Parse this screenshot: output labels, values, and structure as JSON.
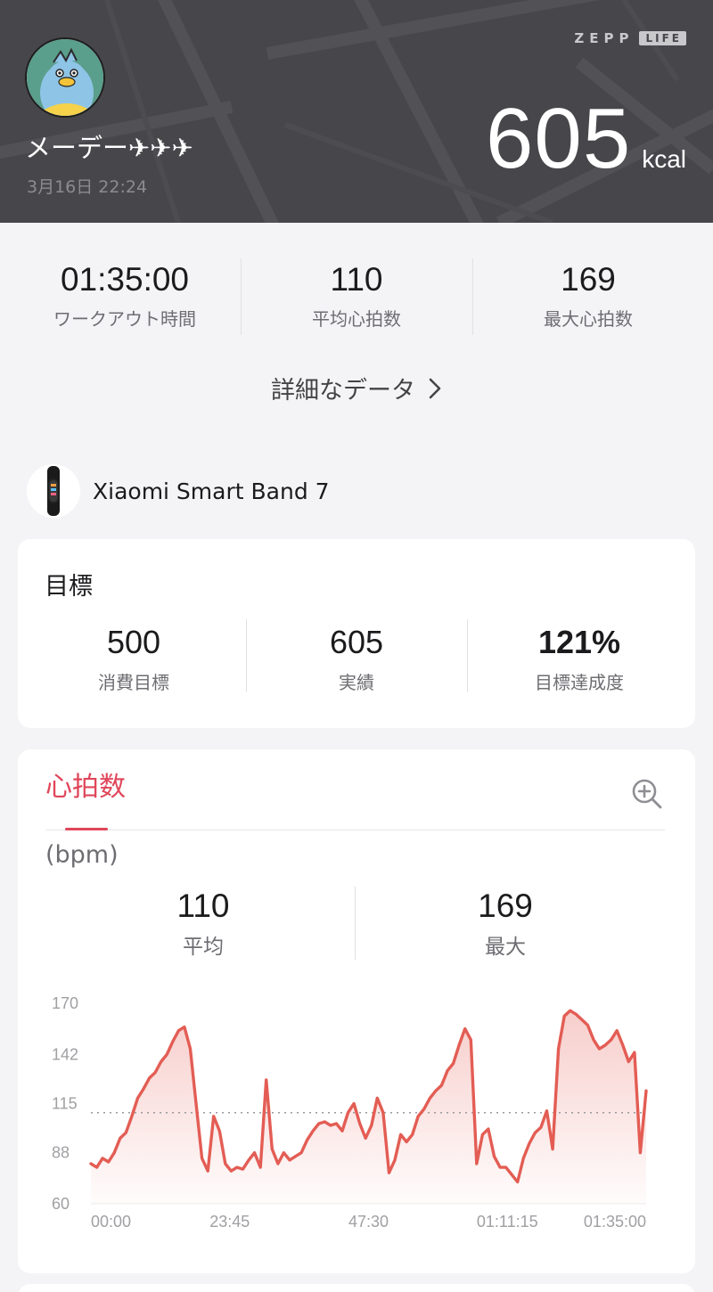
{
  "header": {
    "brand": "ZEPP",
    "brand_badge": "LIFE",
    "username": "メーデー✈✈✈",
    "datetime": "3月16日 22:24",
    "calories": "605",
    "calories_unit": "kcal",
    "background_color": "#47474b"
  },
  "summary": {
    "stats": [
      {
        "value": "01:35:00",
        "label": "ワークアウト時間"
      },
      {
        "value": "110",
        "label": "平均心拍数"
      },
      {
        "value": "169",
        "label": "最大心拍数"
      }
    ],
    "details_link": "詳細なデータ"
  },
  "device": {
    "name": "Xiaomi Smart Band 7",
    "icon": "smart-band-icon"
  },
  "goal": {
    "title": "目標",
    "items": [
      {
        "value": "500",
        "label": "消費目標"
      },
      {
        "value": "605",
        "label": "実績"
      },
      {
        "value": "121%",
        "label": "目標達成度"
      }
    ]
  },
  "heart_rate": {
    "tab": "心拍数",
    "unit_label": "(bpm)",
    "stats": [
      {
        "value": "110",
        "label": "平均"
      },
      {
        "value": "169",
        "label": "最大"
      }
    ],
    "accent_color": "#e0465a",
    "zoom_icon": "zoom-in-icon"
  },
  "chart_data": {
    "type": "area",
    "title": "",
    "xlabel": "",
    "ylabel": "(bpm)",
    "x_unit": "elapsed time",
    "x_ticks": [
      "00:00",
      "23:45",
      "47:30",
      "01:11:15",
      "01:35:00"
    ],
    "y_ticks": [
      "170",
      "142",
      "115",
      "88",
      "60"
    ],
    "ylim": [
      60,
      170
    ],
    "xlim_minutes": [
      0,
      95
    ],
    "average_line": 110,
    "series": [
      {
        "color": "#e35d54",
        "x_minutes": [
          0,
          1,
          2,
          3,
          4,
          5,
          6,
          7,
          8,
          9,
          10,
          11,
          12,
          13,
          14,
          15,
          16,
          17,
          18,
          19,
          20,
          21,
          22,
          23,
          24,
          25,
          26,
          27,
          28,
          29,
          30,
          31,
          32,
          33,
          34,
          35,
          36,
          37,
          38,
          39,
          40,
          41,
          42,
          43,
          44,
          45,
          46,
          47,
          48,
          49,
          50,
          51,
          52,
          53,
          54,
          55,
          56,
          57,
          58,
          59,
          60,
          61,
          62,
          63,
          64,
          65,
          66,
          67,
          68,
          69,
          70,
          71,
          72,
          73,
          74,
          75,
          76,
          77,
          78,
          79,
          80,
          81,
          82,
          83,
          84,
          85,
          86,
          87,
          88,
          89,
          90,
          91,
          92,
          93,
          94,
          95
        ],
        "values": [
          82,
          80,
          85,
          83,
          88,
          96,
          99,
          108,
          118,
          123,
          129,
          132,
          138,
          142,
          149,
          155,
          157,
          145,
          115,
          85,
          78,
          108,
          100,
          82,
          78,
          80,
          79,
          84,
          88,
          80,
          128,
          90,
          82,
          88,
          84,
          86,
          88,
          95,
          100,
          104,
          105,
          103,
          104,
          100,
          110,
          115,
          104,
          96,
          103,
          118,
          110,
          77,
          84,
          98,
          94,
          98,
          108,
          112,
          118,
          122,
          125,
          133,
          137,
          147,
          156,
          150,
          82,
          98,
          101,
          86,
          80,
          80,
          76,
          72,
          85,
          93,
          99,
          102,
          111,
          90,
          145,
          163,
          166,
          164,
          161,
          158,
          150,
          145,
          147,
          150,
          155,
          147,
          138,
          143,
          88,
          122
        ]
      }
    ]
  }
}
